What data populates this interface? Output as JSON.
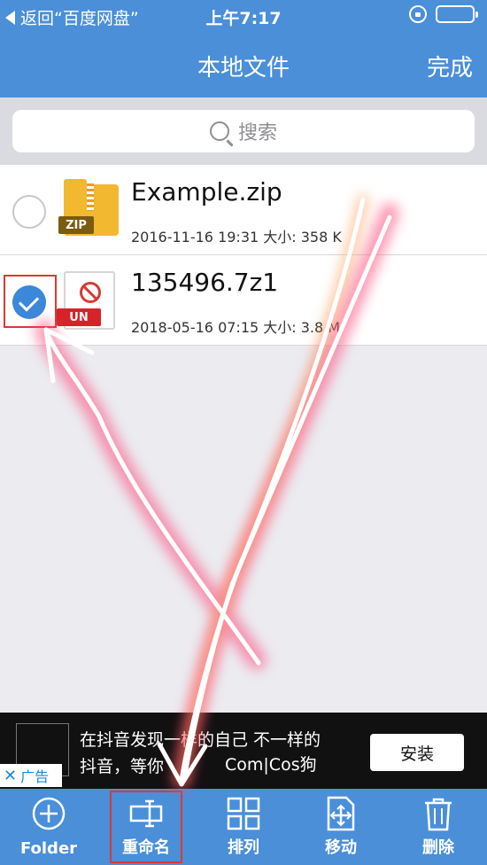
{
  "status_bar": {
    "back_label": "返回“百度网盘”",
    "time": "上午7:17"
  },
  "nav": {
    "title": "本地文件",
    "done_label": "完成"
  },
  "search": {
    "placeholder": "搜索"
  },
  "files": [
    {
      "name": "Example.zip",
      "meta": "2016-11-16 19:31  大小: 358 K",
      "icon_tag": "ZIP",
      "selected": false
    },
    {
      "name": "135496.7z1",
      "meta": "2018-05-16 07:15  大小: 3.8 M",
      "icon_tag": "UN",
      "selected": true
    }
  ],
  "ad": {
    "line1": "在抖音发现一样的自己 不一样的",
    "line2": "抖音，等你",
    "install_label": "安装",
    "badge_label": "广告",
    "watermark": "Com|Cos狗"
  },
  "toolbar": {
    "folder_label": "Folder",
    "rename_label": "重命名",
    "sort_label": "排列",
    "move_label": "移动",
    "delete_label": "删除"
  },
  "colors": {
    "accent": "#4a8fd8",
    "highlight": "#d93a34",
    "checkbox": "#3b87d9"
  }
}
